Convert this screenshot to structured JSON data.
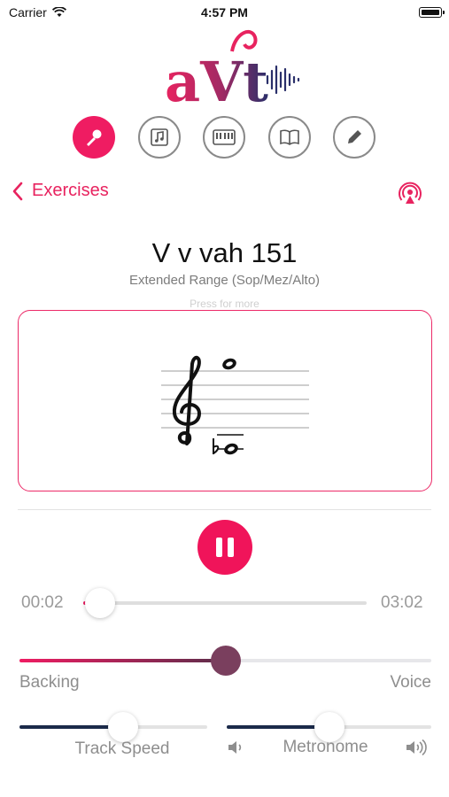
{
  "status_bar": {
    "carrier": "Carrier",
    "time": "4:57 PM"
  },
  "logo": {
    "text": "aVt"
  },
  "toolbar": {
    "items": [
      {
        "icon": "microphone-icon",
        "active": true
      },
      {
        "icon": "music-note-icon",
        "active": false
      },
      {
        "icon": "piano-keyboard-icon",
        "active": false
      },
      {
        "icon": "book-icon",
        "active": false
      },
      {
        "icon": "pencil-icon",
        "active": false
      }
    ]
  },
  "nav": {
    "back_label": "Exercises",
    "airplay_icon": "airplay-icon"
  },
  "exercise": {
    "title": "V v vah 151",
    "subtitle": "Extended Range (Sop/Mez/Alto)",
    "hint": "Press for more"
  },
  "player": {
    "elapsed": "00:02",
    "duration": "03:02",
    "progress_fraction": 0.06
  },
  "mix": {
    "left_label": "Backing",
    "right_label": "Voice",
    "value_fraction": 0.5
  },
  "track_speed": {
    "label": "Track Speed",
    "value_fraction": 0.55
  },
  "metronome": {
    "label": "Metronome",
    "value_fraction": 0.5
  },
  "colors": {
    "accent": "#ef1c62",
    "navy": "#1b2a4a",
    "mix_knob": "#7a3f5e"
  }
}
